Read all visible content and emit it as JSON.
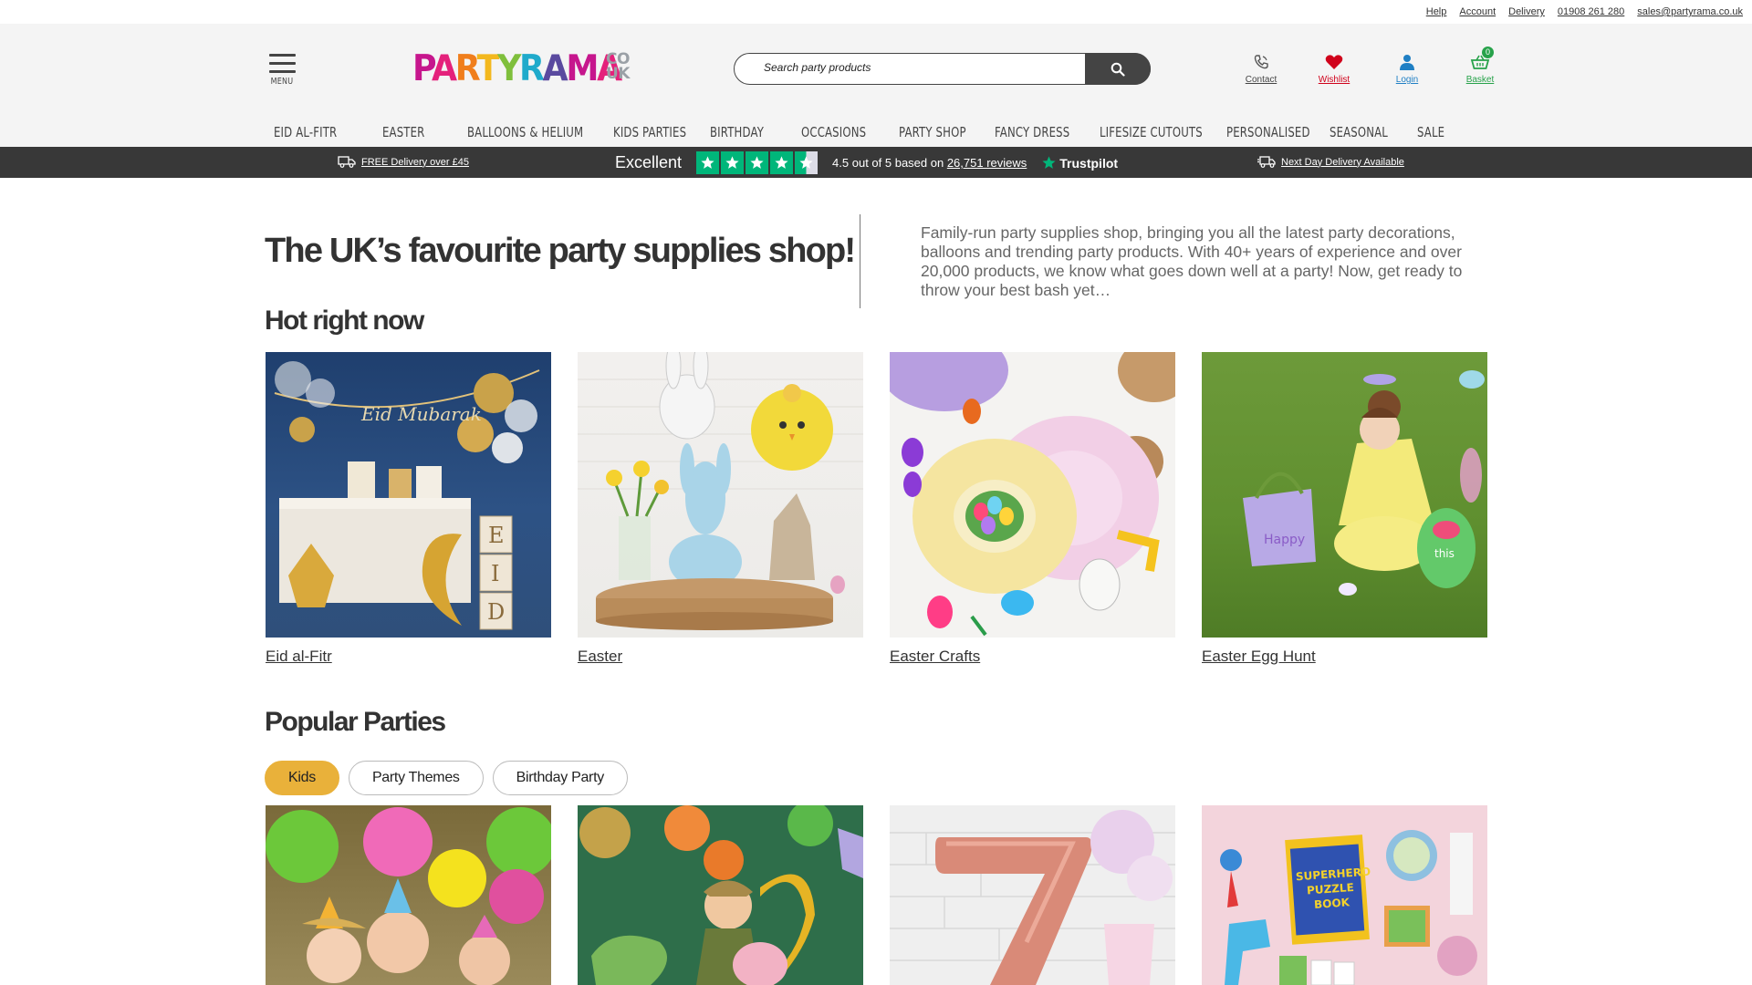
{
  "util_links": [
    "Help",
    "Account",
    "Delivery",
    "01908 261 280",
    "sales@partyrama.co.uk"
  ],
  "header": {
    "menu_label": "MENU",
    "logo_text": "PARTYRAMA",
    "logo_suffix": "CO UK",
    "search_placeholder": "Search party products",
    "icons": {
      "contact": "Contact",
      "wishlist": "Wishlist",
      "login": "Login",
      "basket": "Basket",
      "basket_count": "0"
    }
  },
  "nav": [
    "EID AL-FITR",
    "EASTER",
    "BALLOONS & HELIUM",
    "KIDS PARTIES",
    "BIRTHDAY",
    "OCCASIONS",
    "PARTY SHOP",
    "FANCY DRESS",
    "LIFESIZE CUTOUTS",
    "PERSONALISED",
    "SEASONAL",
    "SALE"
  ],
  "trust_bar": {
    "free_delivery": "FREE Delivery over £45",
    "excellent": "Excellent",
    "rating_prefix": "4.5 out of 5 based on",
    "review_count": "26,751 reviews",
    "trustpilot": "Trustpilot",
    "next_day": "Next Day Delivery Available",
    "rating_value": 4.5
  },
  "intro": {
    "title": "The UK’s favourite party supplies shop!",
    "text": "Family-run party supplies shop, bringing you all the latest party decorations, balloons and trending party products. With 40+ years of experience and over 20,000 products, we know what goes down well at a party! Now, get ready to throw your best bash yet…"
  },
  "hot": {
    "title": "Hot right now",
    "items": [
      "Eid al-Fitr",
      "Easter",
      "Easter Crafts",
      "Easter Egg Hunt"
    ]
  },
  "popular": {
    "title": "Popular Parties",
    "tabs": [
      "Kids",
      "Party Themes",
      "Birthday Party"
    ],
    "active_tab": "Kids"
  },
  "colors": {
    "header_bg": "#f4f4f4",
    "trust_bar_bg": "#383838",
    "trustpilot_green": "#00b67a",
    "active_tab": "#e9b13a",
    "wishlist_red": "#d0021b",
    "login_blue": "#1f7fc4",
    "basket_green": "#27a24a"
  }
}
